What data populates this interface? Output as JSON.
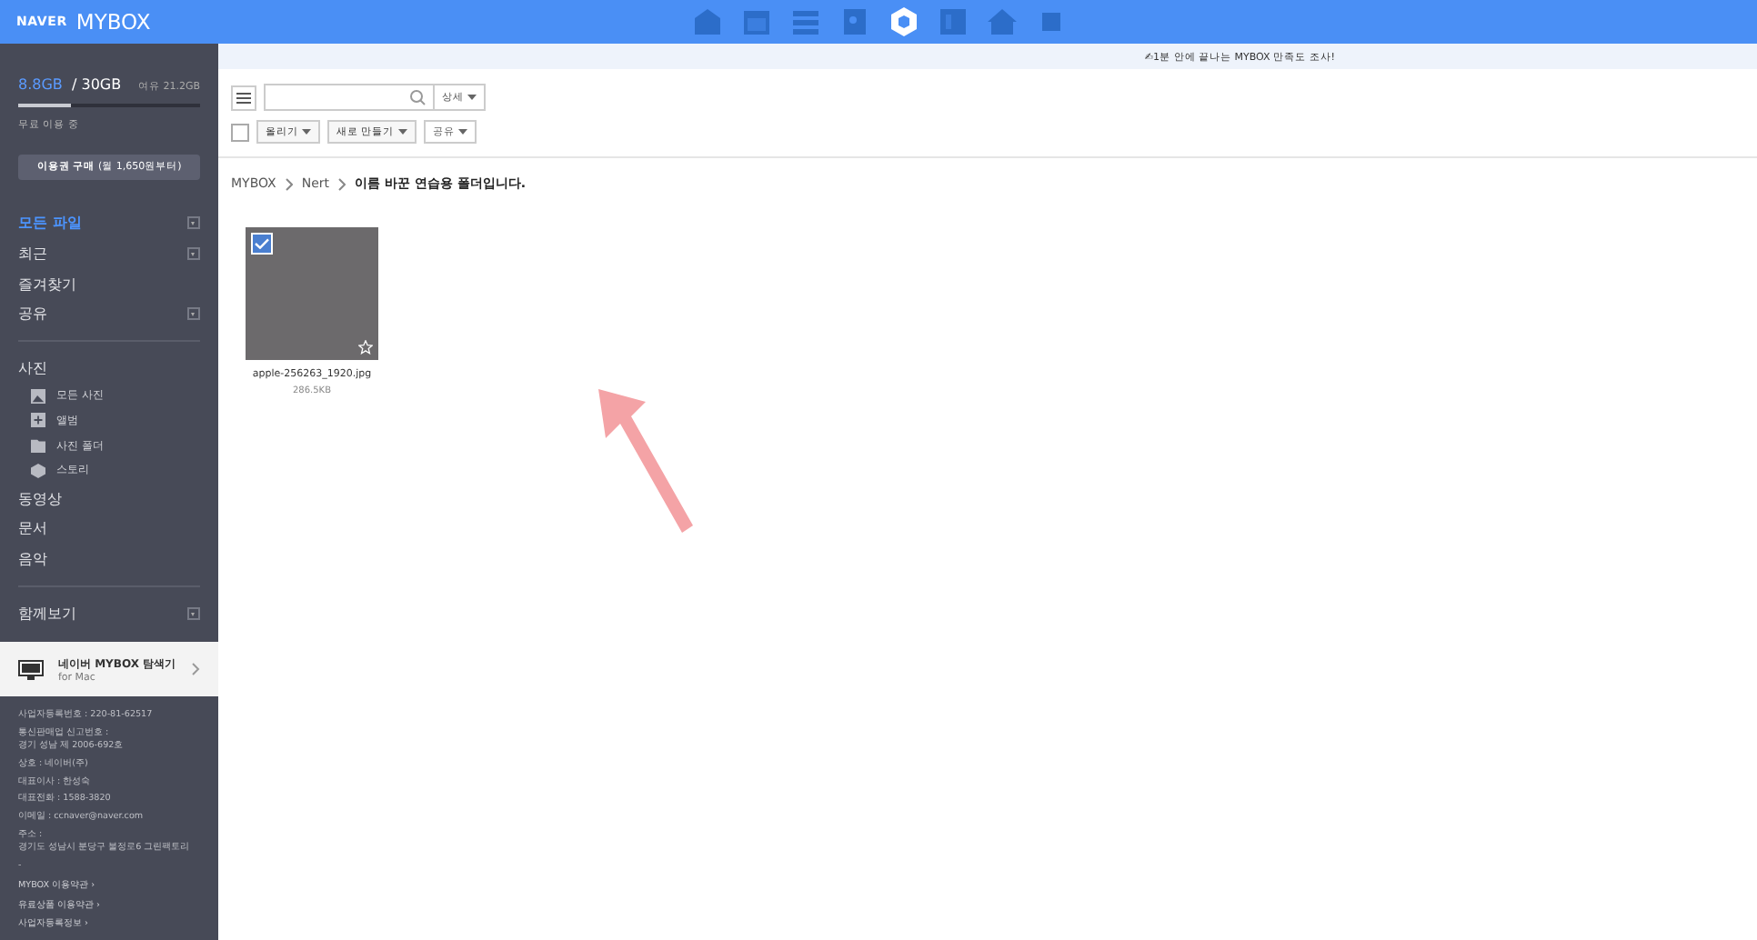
{
  "brand": {
    "naver": "NAVER",
    "product": "MYBOX"
  },
  "storage": {
    "used": "8.8GB",
    "total": "/ 30GB",
    "free": "여유 21.2GB",
    "level": 0.29,
    "plan": "무료 이용 중",
    "buy_button": "이용권 구매",
    "buy_note": "(월 1,650원부터)"
  },
  "sidebar": {
    "sections": [
      {
        "items": [
          {
            "label": "모든 파일",
            "selected": true,
            "dropdown": true
          },
          {
            "label": "최근",
            "selected": false,
            "dropdown": true
          },
          {
            "label": "즐겨찾기",
            "selected": false,
            "dropdown": false
          },
          {
            "label": "공유",
            "selected": false,
            "dropdown": true
          }
        ]
      },
      {
        "items": [
          {
            "label": "사진",
            "selected": false,
            "dropdown": false,
            "children": [
              {
                "label": "모든 사진",
                "kind": "photo"
              },
              {
                "label": "앨범",
                "kind": "album"
              },
              {
                "label": "사진 폴더",
                "kind": "folder"
              },
              {
                "label": "스토리",
                "kind": "story"
              }
            ]
          },
          {
            "label": "동영상",
            "selected": false,
            "dropdown": false
          },
          {
            "label": "문서",
            "selected": false,
            "dropdown": false
          },
          {
            "label": "음악",
            "selected": false,
            "dropdown": false
          }
        ]
      },
      {
        "items": [
          {
            "label": "함께보기",
            "selected": false,
            "dropdown": true
          }
        ]
      }
    ]
  },
  "app_promo": {
    "title": "네이버 MYBOX 탐색기",
    "subtitle": "for Mac"
  },
  "footer": {
    "lines": [
      "사업자등록번호 : 220-81-62517",
      "통신판매업 신고번호 :",
      "경기 성남 제 2006-692호",
      "상호 : 네이버(주)",
      "대표이사 : 한성숙",
      "대표전화 : 1588-3820",
      "이메일 : ccnaver@naver.com",
      "주소 :",
      "경기도 성남시 분당구 불정로6 그린팩토리",
      "-"
    ],
    "links": [
      "MYBOX 이용약관 ›",
      "유료상품 이용약관 ›",
      "사업자등록정보 ›"
    ]
  },
  "top_apps": [
    {
      "kind": "mail",
      "selected": false
    },
    {
      "kind": "calendar",
      "selected": false
    },
    {
      "kind": "list",
      "selected": false
    },
    {
      "kind": "contacts",
      "selected": false
    },
    {
      "kind": "mybox",
      "selected": true
    },
    {
      "kind": "board",
      "selected": false
    },
    {
      "kind": "home",
      "selected": false
    },
    {
      "kind": "more",
      "selected": false
    }
  ],
  "notice": "✍1분 안에 끝나는 MYBOX 만족도 조사!",
  "toolbar": {
    "detail_button": "상세",
    "select_all_checked": false,
    "buttons": [
      "올리기",
      "새로 만들기",
      "공유"
    ]
  },
  "breadcrumb": [
    "MYBOX",
    "Nert",
    "이름 바꾼 연습용 폴더입니다."
  ],
  "files": [
    {
      "name": "apple-256263_1920.jpg",
      "size": "286.5KB",
      "checked": true,
      "starred": false
    }
  ]
}
